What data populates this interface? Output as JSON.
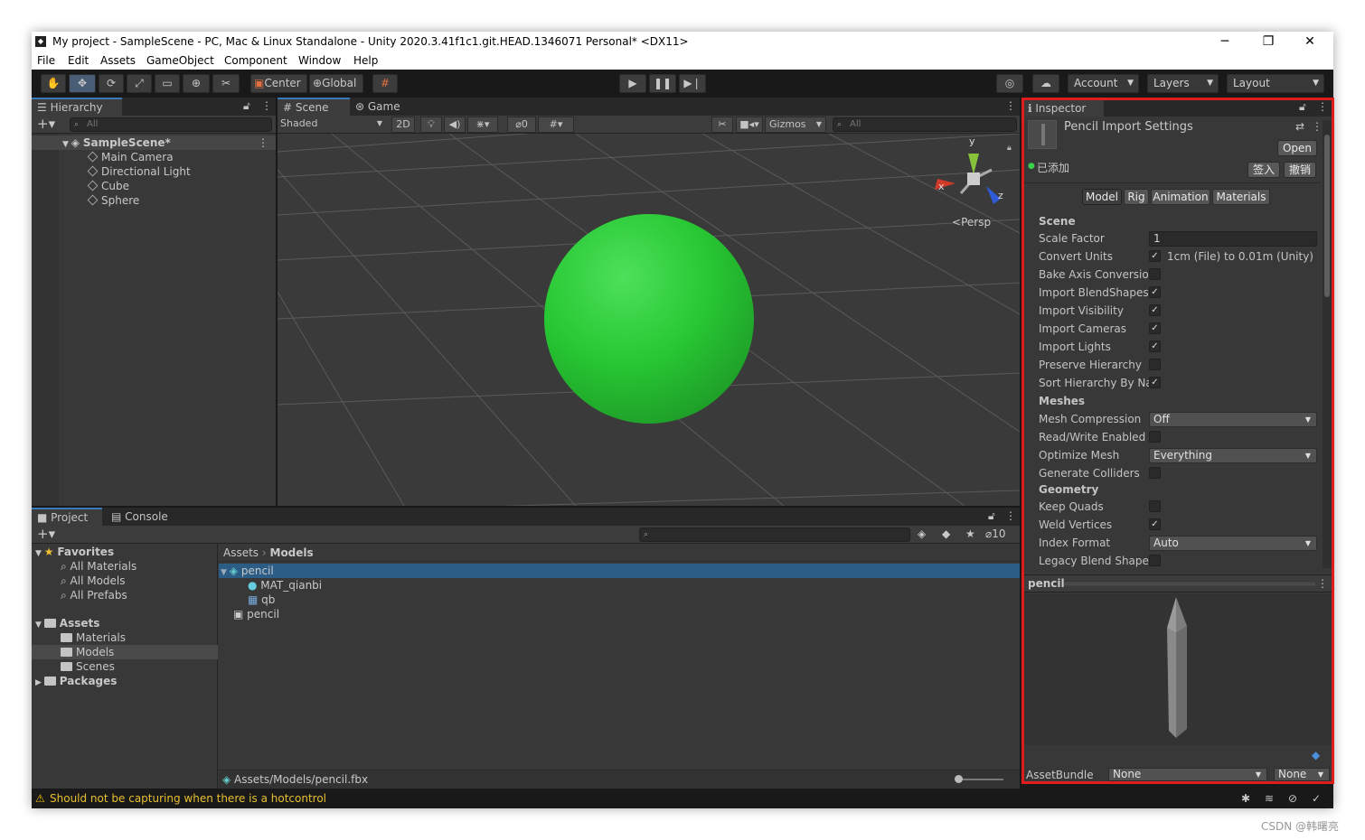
{
  "window": {
    "title": "My project - SampleScene - PC, Mac & Linux Standalone - Unity 2020.3.41f1c1.git.HEAD.1346071 Personal* <DX11>",
    "minimize": "─",
    "maximize": "❐",
    "close": "✕"
  },
  "menu": [
    "File",
    "Edit",
    "Assets",
    "GameObject",
    "Component",
    "Window",
    "Help"
  ],
  "toolbar": {
    "center": "Center",
    "global": "Global",
    "account": "Account",
    "layers": "Layers",
    "layout": "Layout"
  },
  "hierarchy": {
    "tab": "Hierarchy",
    "search_placeholder": "All",
    "scene": "SampleScene*",
    "items": [
      "Main Camera",
      "Directional Light",
      "Cube",
      "Sphere"
    ]
  },
  "scene_view": {
    "tab_scene": "Scene",
    "tab_game": "Game",
    "shading": "Shaded",
    "mode_2d": "2D",
    "hidden_count": "0",
    "gizmos": "Gizmos",
    "search_placeholder": "All",
    "persp": "Persp",
    "axis_y": "y",
    "axis_x": "x",
    "axis_z": "z",
    "sphere_color": "#27c733"
  },
  "project": {
    "tab_project": "Project",
    "tab_console": "Console",
    "count_badge": "10",
    "favorites": {
      "label": "Favorites",
      "items": [
        "All Materials",
        "All Models",
        "All Prefabs"
      ]
    },
    "assets": {
      "label": "Assets",
      "items": [
        "Materials",
        "Models",
        "Scenes"
      ]
    },
    "packages": "Packages",
    "breadcrumb": [
      "Assets",
      "Models"
    ],
    "files": [
      "pencil",
      "MAT_qianbi",
      "qb",
      "pencil"
    ],
    "path": "Assets/Models/pencil.fbx"
  },
  "inspector": {
    "tab": "Inspector",
    "title": "Pencil Import Settings",
    "open_btn": "Open",
    "vc_status": "已添加",
    "checkin_btn": "签入",
    "revert_btn": "撤销",
    "tabs": [
      "Model",
      "Rig",
      "Animation",
      "Materials"
    ],
    "active_tab": "Model",
    "sections": {
      "scene": "Scene",
      "meshes": "Meshes",
      "geometry": "Geometry"
    },
    "rows": {
      "scale_factor": {
        "label": "Scale Factor",
        "value": "1"
      },
      "convert_units": {
        "label": "Convert Units",
        "checked": true,
        "note": "1cm (File) to 0.01m (Unity)"
      },
      "bake_axis": {
        "label": "Bake Axis Conversior",
        "checked": false
      },
      "import_blendshapes": {
        "label": "Import BlendShapes",
        "checked": true
      },
      "import_visibility": {
        "label": "Import Visibility",
        "checked": true
      },
      "import_cameras": {
        "label": "Import Cameras",
        "checked": true
      },
      "import_lights": {
        "label": "Import Lights",
        "checked": true
      },
      "preserve_hierarchy": {
        "label": "Preserve Hierarchy",
        "checked": false
      },
      "sort_hierarchy": {
        "label": "Sort Hierarchy By Na",
        "checked": true
      },
      "mesh_compression": {
        "label": "Mesh Compression",
        "value": "Off"
      },
      "read_write": {
        "label": "Read/Write Enabled",
        "checked": false
      },
      "optimize_mesh": {
        "label": "Optimize Mesh",
        "value": "Everything"
      },
      "generate_colliders": {
        "label": "Generate Colliders",
        "checked": false
      },
      "keep_quads": {
        "label": "Keep Quads",
        "checked": false
      },
      "weld_vertices": {
        "label": "Weld Vertices",
        "checked": true
      },
      "index_format": {
        "label": "Index Format",
        "value": "Auto"
      },
      "legacy_blend": {
        "label": "Legacy Blend Shape",
        "checked": false
      }
    },
    "preview_title": "pencil",
    "assetbundle_label": "AssetBundle",
    "assetbundle_value": "None",
    "assetbundle_variant": "None"
  },
  "status": {
    "warning": "Should not be capturing when there is a hotcontrol"
  },
  "watermark": "CSDN @韩曙亮"
}
